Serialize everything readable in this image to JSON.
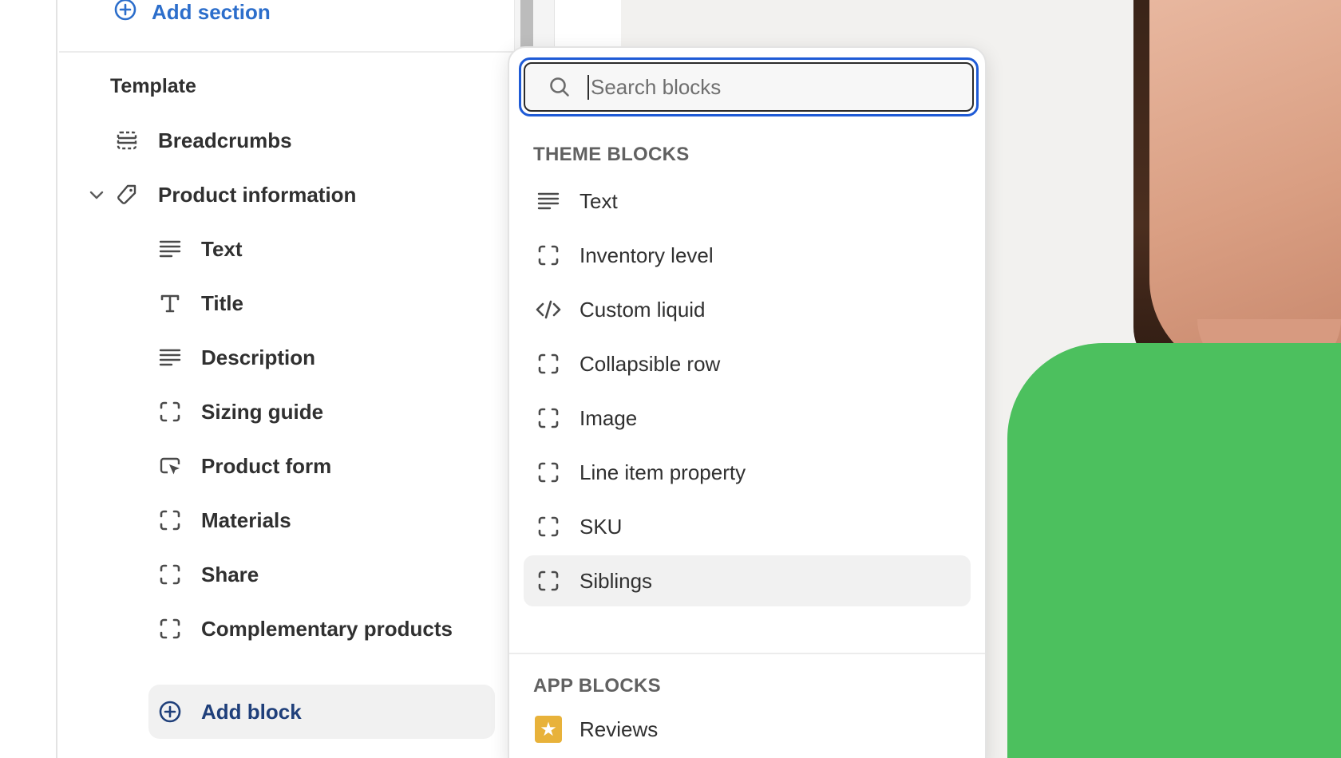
{
  "sidebar": {
    "add_section_label": "Add section",
    "template_heading": "Template",
    "items": [
      {
        "label": "Breadcrumbs",
        "icon": "section-layout-icon"
      },
      {
        "label": "Product information",
        "icon": "tag-icon"
      }
    ],
    "blocks": [
      {
        "label": "Text",
        "icon": "text-lines-icon"
      },
      {
        "label": "Title",
        "icon": "title-t-icon"
      },
      {
        "label": "Description",
        "icon": "text-lines-icon"
      },
      {
        "label": "Sizing guide",
        "icon": "dashed-block-icon"
      },
      {
        "label": "Product form",
        "icon": "cursor-form-icon"
      },
      {
        "label": "Materials",
        "icon": "dashed-block-icon"
      },
      {
        "label": "Share",
        "icon": "dashed-block-icon"
      },
      {
        "label": "Complementary products",
        "icon": "dashed-block-icon"
      }
    ],
    "add_block_label": "Add block"
  },
  "popover": {
    "search_placeholder": "Search blocks",
    "search_value": "",
    "theme_blocks_label": "THEME BLOCKS",
    "theme_blocks": [
      {
        "label": "Text",
        "icon": "text-lines-icon"
      },
      {
        "label": "Inventory level",
        "icon": "dashed-block-icon"
      },
      {
        "label": "Custom liquid",
        "icon": "code-icon"
      },
      {
        "label": "Collapsible row",
        "icon": "dashed-block-icon"
      },
      {
        "label": "Image",
        "icon": "dashed-block-icon"
      },
      {
        "label": "Line item property",
        "icon": "dashed-block-icon"
      },
      {
        "label": "SKU",
        "icon": "dashed-block-icon"
      },
      {
        "label": "Siblings",
        "icon": "dashed-block-icon",
        "hovered": true
      }
    ],
    "app_blocks_label": "APP BLOCKS",
    "app_blocks": [
      {
        "label": "Reviews",
        "icon": "star-icon"
      }
    ]
  },
  "colors": {
    "link_blue": "#2c6ecb",
    "focus_ring": "#1f5bd6",
    "shirt_green": "#4cc05e",
    "hover_bg": "#f1f1f1"
  }
}
